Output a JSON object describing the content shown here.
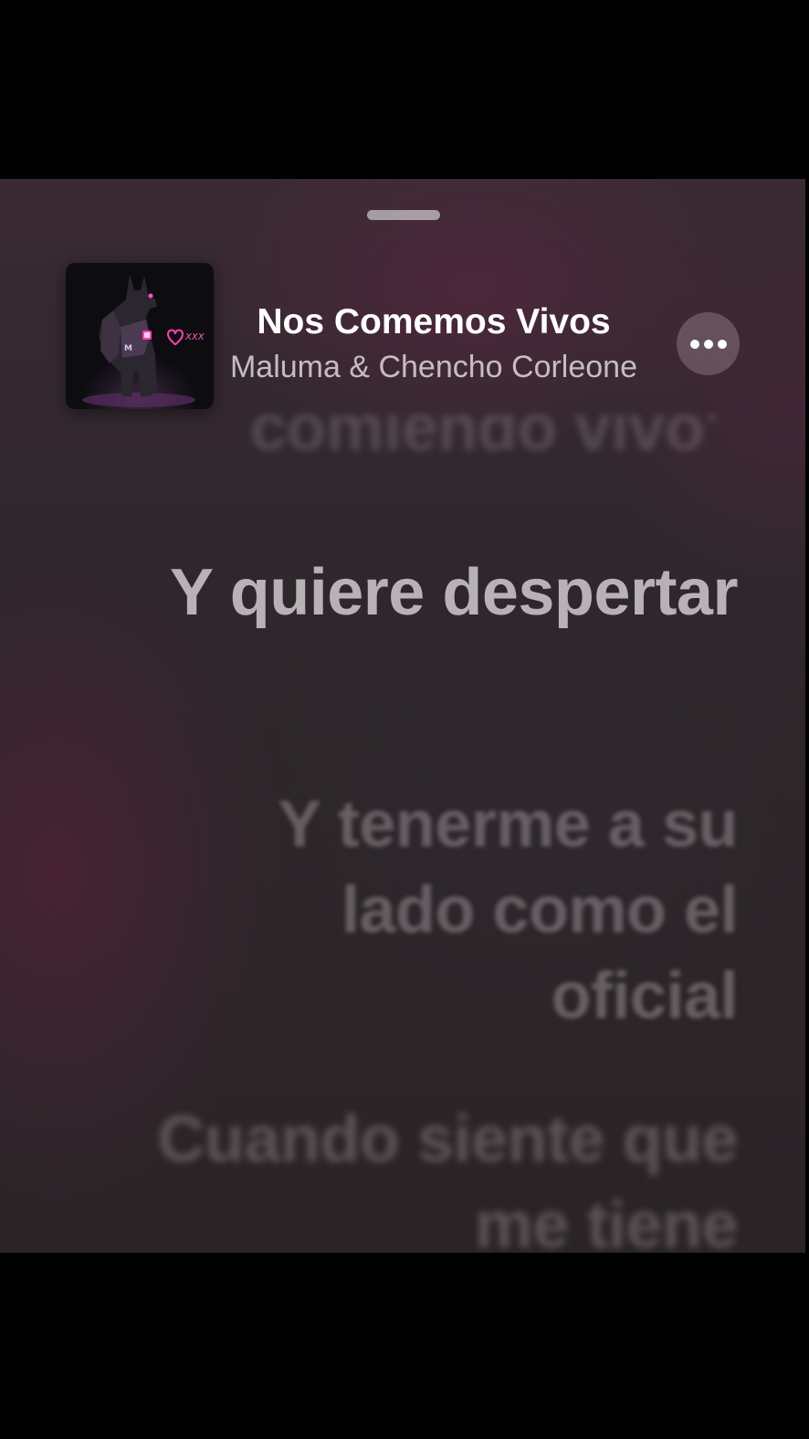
{
  "now_playing": {
    "title": "Nos Comemos Vivos",
    "artist": "Maluma & Chencho Corleone",
    "artwork_text": "XXX"
  },
  "more_button": {
    "icon": "ellipsis-icon"
  },
  "lyrics": {
    "previous": "comiendo vivo'",
    "current": "Y quiere despertar",
    "next": "Y tenerme a su lado como el oficial",
    "next_2": "Cuando siente que me tiene"
  },
  "colors": {
    "background_top": "#3b2a33",
    "background_bottom": "#2a2427",
    "title": "#ffffff",
    "artwork_accent": "#ff3fb0"
  }
}
